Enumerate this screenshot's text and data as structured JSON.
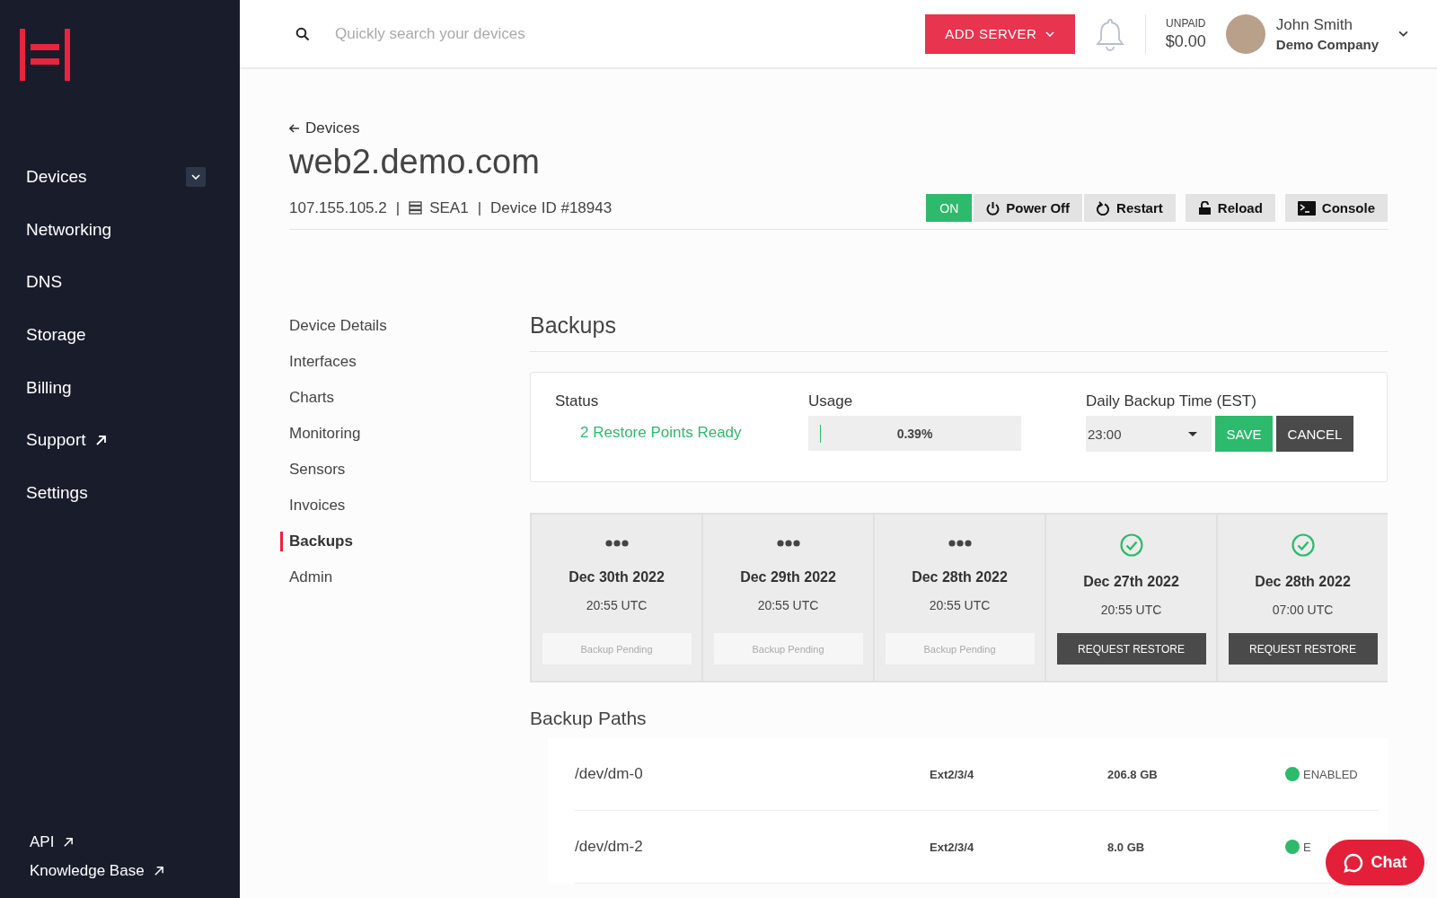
{
  "sidebar": {
    "items": [
      {
        "label": "Devices",
        "kind": "expandable"
      },
      {
        "label": "Networking",
        "kind": "plain"
      },
      {
        "label": "DNS",
        "kind": "plain"
      },
      {
        "label": "Storage",
        "kind": "plain"
      },
      {
        "label": "Billing",
        "kind": "plain"
      },
      {
        "label": "Support",
        "kind": "external"
      },
      {
        "label": "Settings",
        "kind": "plain"
      }
    ],
    "footer_links": [
      "API",
      "Knowledge Base"
    ]
  },
  "topbar": {
    "search": {
      "placeholder": "Quickly search your devices"
    },
    "add_button": "ADD SERVER",
    "balance_label": "UNPAID",
    "balance": "$0.00",
    "user_name": "John Smith",
    "company": "Demo Company"
  },
  "device": {
    "back_link": "Devices",
    "title": "web2.demo.com",
    "ip": "107.155.105.2",
    "separators": [
      "|",
      "|"
    ],
    "location": "SEA1",
    "device_id": "Device ID #18943",
    "power": {
      "label": "ON",
      "on": true
    },
    "actions": [
      "Power Off",
      "Restart",
      "Reload",
      "Console"
    ]
  },
  "subnav": [
    {
      "label": "Device Details",
      "selected": false
    },
    {
      "label": "Interfaces",
      "selected": false
    },
    {
      "label": "Charts",
      "selected": false
    },
    {
      "label": "Monitoring",
      "selected": false
    },
    {
      "label": "Sensors",
      "selected": false
    },
    {
      "label": "Invoices",
      "selected": false
    },
    {
      "label": "Backups",
      "selected": true
    },
    {
      "label": "Admin",
      "selected": false
    }
  ],
  "backups": {
    "title": "Backups",
    "status_label": "Status",
    "status": "2 Restore Points Ready",
    "usage_label": "Usage",
    "usage": {
      "level": 0.0039,
      "reading": "0.39%"
    },
    "time_label": "Daily Backup Time (EST)",
    "time": "23:00",
    "save": "SAVE",
    "cancel": "CANCEL",
    "points": [
      {
        "kind": "pending",
        "date": "Dec 30th 2022",
        "time": "20:55 UTC",
        "action": "Backup Pending"
      },
      {
        "kind": "pending",
        "date": "Dec 29th 2022",
        "time": "20:55 UTC",
        "action": "Backup Pending"
      },
      {
        "kind": "pending",
        "date": "Dec 28th 2022",
        "time": "20:55 UTC",
        "action": "Backup Pending"
      },
      {
        "kind": "done",
        "date": "Dec 27th 2022",
        "time": "20:55 UTC",
        "action": "REQUEST RESTORE"
      },
      {
        "kind": "done",
        "date": "Dec 28th 2022",
        "time": "07:00 UTC",
        "action": "REQUEST RESTORE"
      }
    ]
  },
  "backup_paths": {
    "title": "Backup Paths",
    "rows": [
      {
        "path": "/dev/dm-0",
        "fs": "Ext2/3/4",
        "size": "206.8 GB",
        "status": "ENABLED",
        "color": "#2dba6c"
      },
      {
        "path": "/dev/dm-2",
        "fs": "Ext2/3/4",
        "size": "8.0 GB",
        "status": "E",
        "color": "#2dba6c"
      }
    ]
  },
  "chat": "Chat"
}
